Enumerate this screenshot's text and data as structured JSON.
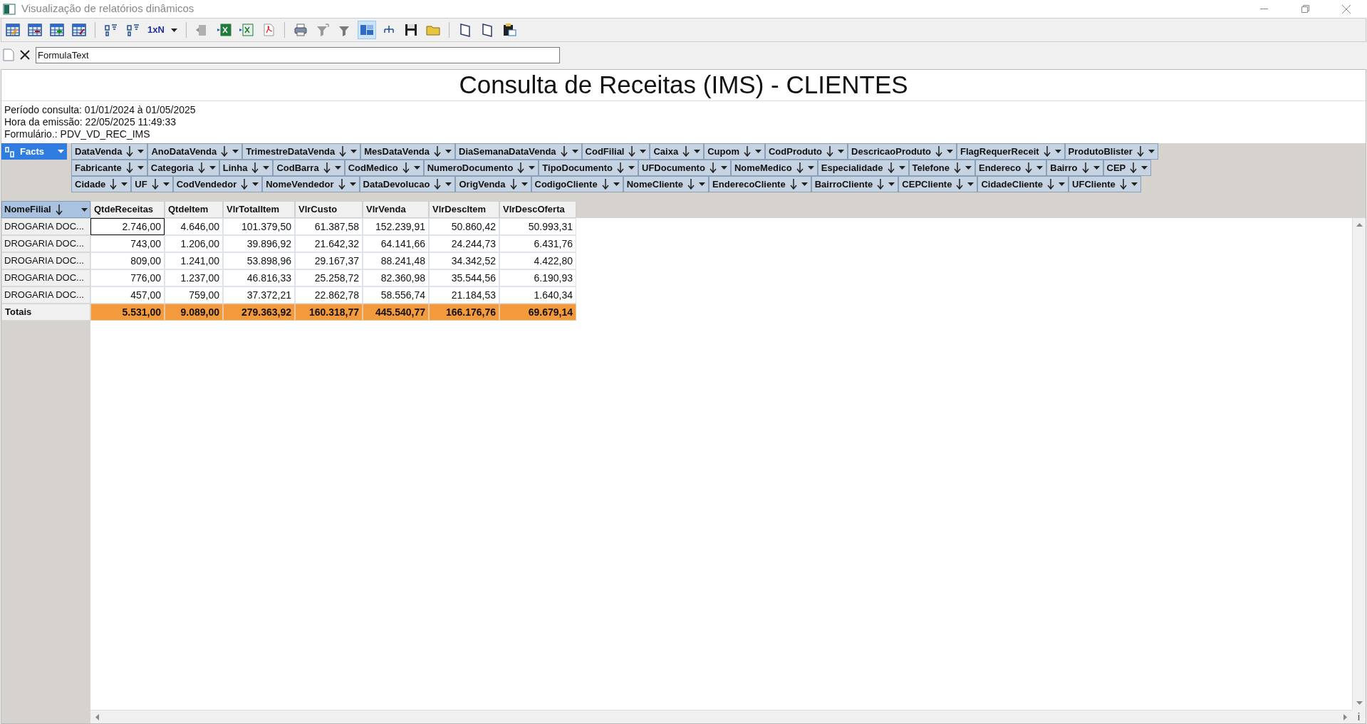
{
  "window": {
    "title": "Visualização de relatórios dinâmicos"
  },
  "toolbar": [
    {
      "kind": "icon",
      "selected": false
    },
    {
      "kind": "icon",
      "selected": false
    },
    {
      "kind": "icon",
      "selected": false
    },
    {
      "kind": "icon",
      "selected": false
    },
    {
      "kind": "separator"
    },
    {
      "kind": "icon",
      "selected": false
    },
    {
      "kind": "icon",
      "selected": false
    },
    {
      "kind": "text",
      "label": "1xN"
    },
    {
      "kind": "caret"
    },
    {
      "kind": "separator"
    },
    {
      "kind": "icon",
      "selected": false
    },
    {
      "kind": "icon",
      "selected": false
    },
    {
      "kind": "icon",
      "selected": false
    },
    {
      "kind": "icon",
      "selected": false
    },
    {
      "kind": "separator"
    },
    {
      "kind": "icon",
      "selected": false
    },
    {
      "kind": "icon",
      "selected": false
    },
    {
      "kind": "icon",
      "selected": false
    },
    {
      "kind": "icon",
      "selected": true
    },
    {
      "kind": "icon",
      "selected": false
    },
    {
      "kind": "icon",
      "selected": false
    },
    {
      "kind": "icon",
      "selected": false
    },
    {
      "kind": "separator"
    },
    {
      "kind": "icon",
      "selected": false
    },
    {
      "kind": "icon",
      "selected": false
    },
    {
      "kind": "icon",
      "selected": false
    }
  ],
  "formula_bar": {
    "value": "FormulaText"
  },
  "report": {
    "title": "Consulta de Receitas (IMS) - CLIENTES",
    "info": [
      "Período consulta: 01/01/2024 à 01/05/2025",
      "Hora da emissão: 22/05/2025 11:49:33",
      "Formulário.: PDV_VD_REC_IMS"
    ]
  },
  "facts": {
    "label": "Facts"
  },
  "filter_fields": [
    [
      "DataVenda",
      "AnoDataVenda",
      "TrimestreDataVenda",
      "MesDataVenda",
      "DiaSemanaDataVenda",
      "CodFilial",
      "Caixa",
      "Cupom",
      "CodProduto",
      "DescricaoProduto",
      "FlagRequerReceit",
      "ProdutoBlister"
    ],
    [
      "Fabricante",
      "Categoria",
      "Linha",
      "CodBarra",
      "CodMedico",
      "NumeroDocumento",
      "TipoDocumento",
      "UFDocumento",
      "NomeMedico",
      "Especialidade",
      "Telefone",
      "Endereco",
      "Bairro",
      "CEP"
    ],
    [
      "Cidade",
      "UF",
      "CodVendedor",
      "NomeVendedor",
      "DataDevolucao",
      "OrigVenda",
      "CodigoCliente",
      "NomeCliente",
      "EnderecoCliente",
      "BairroCliente",
      "CEPCliente",
      "CidadeCliente",
      "UFCliente"
    ]
  ],
  "table": {
    "row_field": "NomeFilial",
    "columns": [
      "QtdeReceitas",
      "QtdeItem",
      "VlrTotalItem",
      "VlrCusto",
      "VlrVenda",
      "VlrDescItem",
      "VlrDescOferta"
    ],
    "rows": [
      {
        "label": "DROGARIA DOC...",
        "cells": [
          {
            "text": "2.746,00",
            "selected": true
          },
          {
            "text": "4.646,00",
            "selected": false
          },
          {
            "text": "101.379,50",
            "selected": false
          },
          {
            "text": "61.387,58",
            "selected": false
          },
          {
            "text": "152.239,91",
            "selected": false
          },
          {
            "text": "50.860,42",
            "selected": false
          },
          {
            "text": "50.993,31",
            "selected": false
          }
        ]
      },
      {
        "label": "DROGARIA DOC...",
        "cells": [
          {
            "text": "743,00",
            "selected": false
          },
          {
            "text": "1.206,00",
            "selected": false
          },
          {
            "text": "39.896,92",
            "selected": false
          },
          {
            "text": "21.642,32",
            "selected": false
          },
          {
            "text": "64.141,66",
            "selected": false
          },
          {
            "text": "24.244,73",
            "selected": false
          },
          {
            "text": "6.431,76",
            "selected": false
          }
        ]
      },
      {
        "label": "DROGARIA DOC...",
        "cells": [
          {
            "text": "809,00",
            "selected": false
          },
          {
            "text": "1.241,00",
            "selected": false
          },
          {
            "text": "53.898,96",
            "selected": false
          },
          {
            "text": "29.167,37",
            "selected": false
          },
          {
            "text": "88.241,48",
            "selected": false
          },
          {
            "text": "34.342,52",
            "selected": false
          },
          {
            "text": "4.422,80",
            "selected": false
          }
        ]
      },
      {
        "label": "DROGARIA DOC...",
        "cells": [
          {
            "text": "776,00",
            "selected": false
          },
          {
            "text": "1.237,00",
            "selected": false
          },
          {
            "text": "46.816,33",
            "selected": false
          },
          {
            "text": "25.258,72",
            "selected": false
          },
          {
            "text": "82.360,98",
            "selected": false
          },
          {
            "text": "35.544,56",
            "selected": false
          },
          {
            "text": "6.190,93",
            "selected": false
          }
        ]
      },
      {
        "label": "DROGARIA DOC...",
        "cells": [
          {
            "text": "457,00",
            "selected": false
          },
          {
            "text": "759,00",
            "selected": false
          },
          {
            "text": "37.372,21",
            "selected": false
          },
          {
            "text": "22.862,78",
            "selected": false
          },
          {
            "text": "58.556,74",
            "selected": false
          },
          {
            "text": "21.184,53",
            "selected": false
          },
          {
            "text": "1.640,34",
            "selected": false
          }
        ]
      }
    ],
    "totals": {
      "label": "Totais",
      "cells": [
        "5.531,00",
        "9.089,00",
        "279.363,92",
        "160.318,77",
        "445.540,77",
        "166.176,76",
        "69.679,14"
      ]
    }
  }
}
